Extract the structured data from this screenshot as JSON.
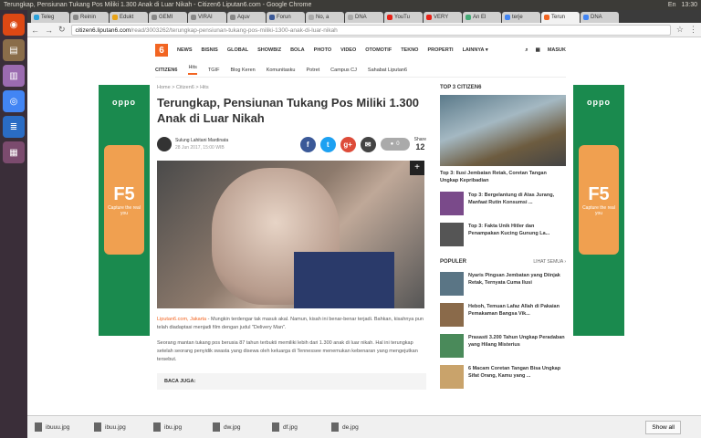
{
  "window_title": "Terungkap, Pensiunan Tukang Pos Miliki 1.300 Anak di Luar Nikah - Citizen6 Liputan6.com - Google Chrome",
  "system_tray": [
    "En",
    "13:30"
  ],
  "tabs": [
    {
      "label": "Teleg",
      "color": "#2aa1da"
    },
    {
      "label": "Reinin",
      "color": "#888"
    },
    {
      "label": "Edukt",
      "color": "#e8a317"
    },
    {
      "label": "GEMI",
      "color": "#888"
    },
    {
      "label": "VIRAI",
      "color": "#888"
    },
    {
      "label": "Aquv",
      "color": "#888"
    },
    {
      "label": "Forun",
      "color": "#3b5998"
    },
    {
      "label": "No, a",
      "color": "#aaa"
    },
    {
      "label": "DNA",
      "color": "#aaa"
    },
    {
      "label": "YouTu",
      "color": "#e62117"
    },
    {
      "label": "VERY",
      "color": "#e62117"
    },
    {
      "label": "An El",
      "color": "#4a7"
    },
    {
      "label": "terje",
      "color": "#4285f4"
    },
    {
      "label": "Terun",
      "color": "#f26522"
    },
    {
      "label": "DNA",
      "color": "#4285f4"
    }
  ],
  "url": {
    "host": "citizen6.liputan6.com",
    "path": "/read/3003262/terungkap-pensiunan-tukang-pos-miliki-1300-anak-di-luar-nikah"
  },
  "site_nav": {
    "logo": "6",
    "items": [
      "NEWS",
      "BISNIS",
      "GLOBAL",
      "SHOWBIZ",
      "BOLA",
      "PHOTO",
      "VIDEO",
      "OTOMOTIF",
      "TEKNO",
      "PROPERTI",
      "LAINNYA ▾"
    ],
    "login": "MASUK"
  },
  "sub_nav": {
    "brand": "CITIZEN6",
    "items": [
      "Hits",
      "TGIF",
      "Blog Keren",
      "Komunitasku",
      "Potret",
      "Campus CJ",
      "Sahabat Liputan6"
    ]
  },
  "ad": {
    "brand": "oppo",
    "model": "F5",
    "caption": "Capture the real you"
  },
  "article": {
    "breadcrumb": [
      "Home",
      "Citizen6",
      "Hits"
    ],
    "title": "Terungkap, Pensiunan Tukang Pos Miliki 1.300 Anak di Luar Nikah",
    "author": "Sulung Lahitani Mardinata",
    "date": "28 Jun 2017, 15:00 WIB",
    "comments": "0",
    "share_label": "Share",
    "share_count": "12",
    "source": "Liputan6.com, Jakarta",
    "para1": " - Mungkin terdengar tak masuk akal. Namun, kisah ini benar-benar terjadi. Bahkan, kisahnya pun telah diadaptasi menjadi film dengan judul \"Delivery Man\".",
    "para2": "Seorang mantan tukang pos berusia 87 tahun terbukti memiliki lebih dari 1.300 anak di luar nikah. Hal ini terungkap setelah seorang penyidik swasta yang disewa oleh keluarga di Tennessee menemukan kebenaran yang mengejutkan tersebut.",
    "baca_juga": "BACA JUGA:"
  },
  "sidebar": {
    "top_title": "TOP 3 CITIZEN6",
    "feature_title": "Top 3: Ilusi Jembatan Retak, Coretan Tangan Ungkap Kepribadian",
    "top_items": [
      "Top 3: Bergelantung di Atas Jurang, Manfaat Rutin Konsumsi ...",
      "Top 3: Fakta Unik Hitler dan Penampakan Kucing Gunung La..."
    ],
    "popular_title": "POPULER",
    "see_all": "LIHAT SEMUA ›",
    "popular_items": [
      "Nyaris Pingsan Jembatan yang Diinjak Retak, Ternyata Cuma Ilusi",
      "Heboh, Temuan Lafaz Allah di Pakaian Pemakaman Bangsa Vik...",
      "Prasasti 3.200 Tahun Ungkap Peradaban yang Hilang Misterius",
      "6 Macam Coretan Tangan Bisa Ungkap Sifat Orang, Kamu yang ..."
    ]
  },
  "downloads": [
    "ibuuu.jpg",
    "ibuu.jpg",
    "ibu.jpg",
    "dw.jpg",
    "df.jpg",
    "de.jpg"
  ],
  "show_all": "Show all"
}
